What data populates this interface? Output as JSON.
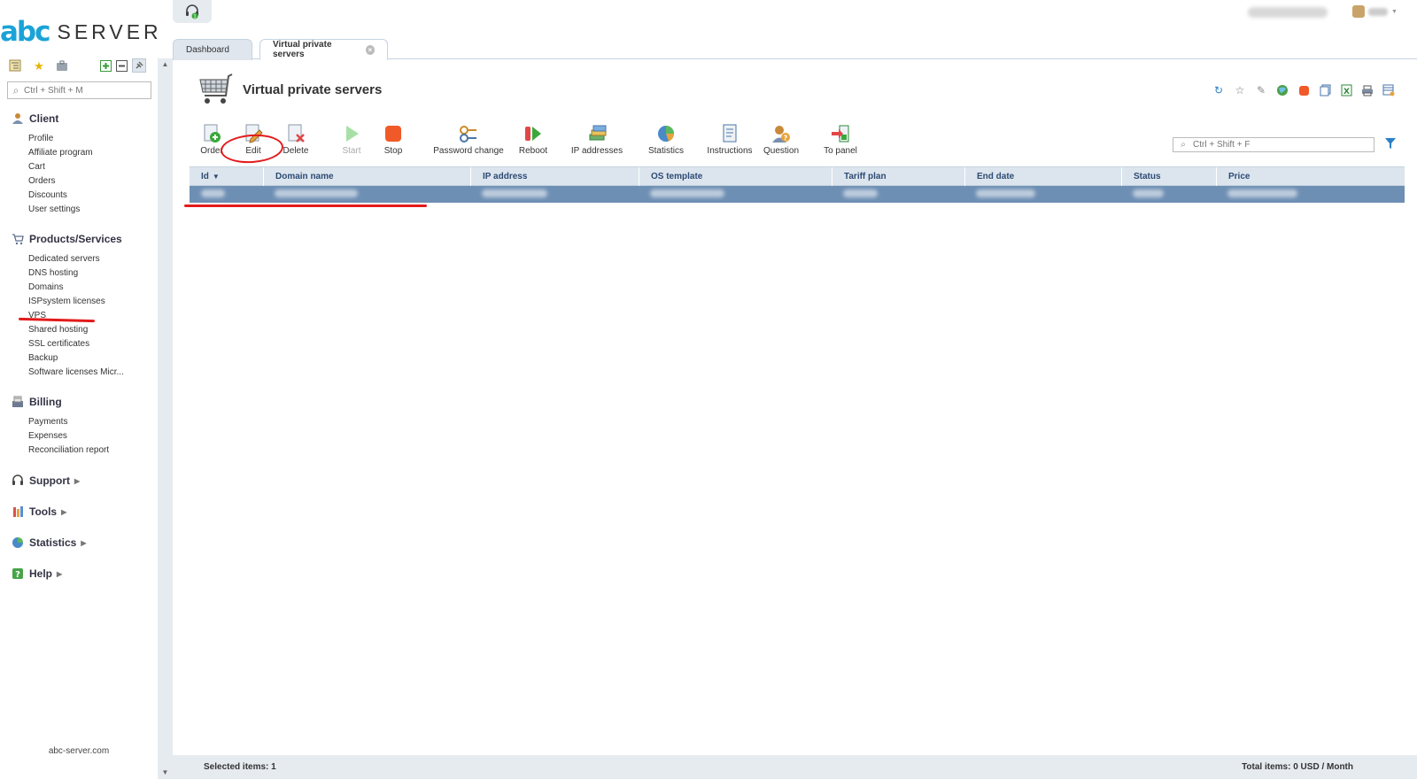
{
  "logo": {
    "mark": "abc",
    "word": "SERVER"
  },
  "sidebar": {
    "search_placeholder": "Ctrl + Shift + M",
    "groups": [
      {
        "title": "Client",
        "icon": "user-icon",
        "items": [
          "Profile",
          "Affiliate program",
          "Cart",
          "Orders",
          "Discounts",
          "User settings"
        ]
      },
      {
        "title": "Products/Services",
        "icon": "cart-icon",
        "items": [
          "Dedicated servers",
          "DNS hosting",
          "Domains",
          "ISPsystem licenses",
          "VPS",
          "Shared hosting",
          "SSL certificates",
          "Backup",
          "Software licenses Micr..."
        ]
      },
      {
        "title": "Billing",
        "icon": "billing-icon",
        "items": [
          "Payments",
          "Expenses",
          "Reconciliation report"
        ]
      },
      {
        "title": "Support",
        "icon": "headset-icon",
        "items": []
      },
      {
        "title": "Tools",
        "icon": "tools-icon",
        "items": []
      },
      {
        "title": "Statistics",
        "icon": "pie-chart-icon",
        "items": []
      },
      {
        "title": "Help",
        "icon": "help-icon",
        "items": []
      }
    ],
    "footer": "abc-server.com"
  },
  "tabs": [
    {
      "label": "Dashboard",
      "active": false
    },
    {
      "label": "Virtual private servers",
      "active": true
    }
  ],
  "page": {
    "title": "Virtual private servers"
  },
  "toolbar": [
    {
      "label": "Order",
      "icon": "order-icon",
      "enabled": true
    },
    {
      "label": "Edit",
      "icon": "edit-icon",
      "enabled": true
    },
    {
      "label": "Delete",
      "icon": "delete-icon",
      "enabled": true
    },
    {
      "label": "Start",
      "icon": "start-icon",
      "enabled": false
    },
    {
      "label": "Stop",
      "icon": "stop-icon",
      "enabled": true
    },
    {
      "label": "Password change",
      "icon": "key-icon",
      "enabled": true
    },
    {
      "label": "Reboot",
      "icon": "reboot-icon",
      "enabled": true
    },
    {
      "label": "IP addresses",
      "icon": "ip-addresses-icon",
      "enabled": true
    },
    {
      "label": "Statistics",
      "icon": "statistics-icon",
      "enabled": true
    },
    {
      "label": "Instructions",
      "icon": "instructions-icon",
      "enabled": true
    },
    {
      "label": "Question",
      "icon": "question-icon",
      "enabled": true
    },
    {
      "label": "To panel",
      "icon": "to-panel-icon",
      "enabled": true
    }
  ],
  "filter": {
    "placeholder": "Ctrl + Shift + F"
  },
  "table": {
    "columns": [
      "Id",
      "Domain name",
      "IP address",
      "OS template",
      "Tariff plan",
      "End date",
      "Status",
      "Price"
    ],
    "sort_column": "Id"
  },
  "statusbar": {
    "selected": "Selected items: 1",
    "total": "Total items: 0 USD / Month"
  },
  "colors": {
    "brand": "#1aa3d8",
    "selected_row": "#6e8fb4",
    "header_bg": "#dce5ee",
    "annotation": "#e31b1b"
  }
}
